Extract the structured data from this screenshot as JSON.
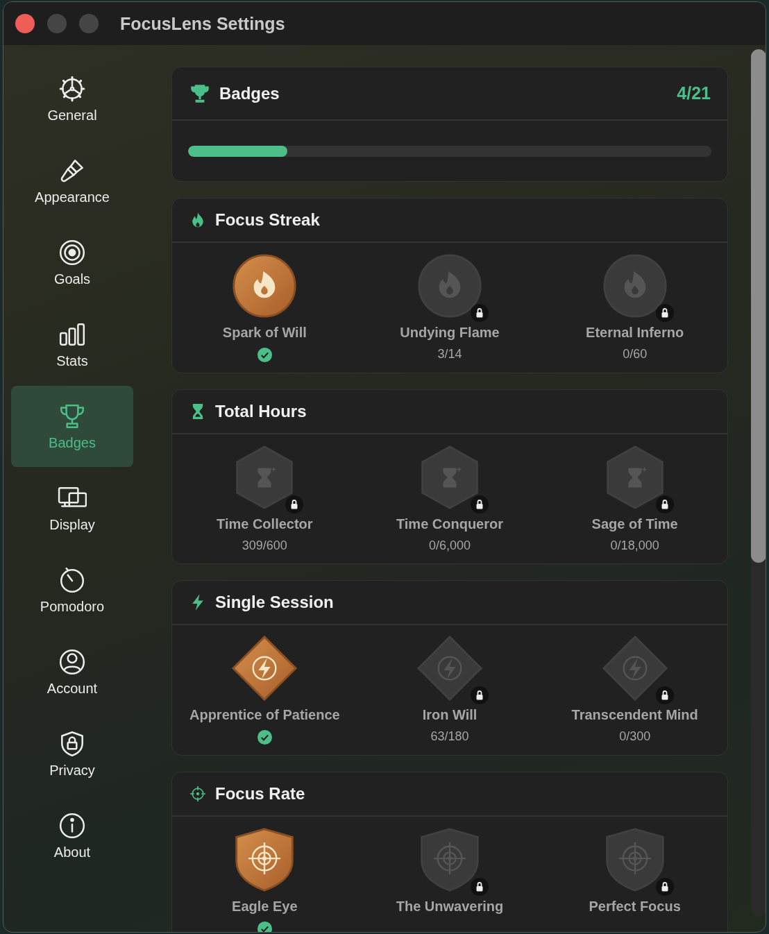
{
  "window": {
    "title": "FocusLens Settings"
  },
  "sidebar": {
    "items": [
      {
        "label": "General",
        "selected": false
      },
      {
        "label": "Appearance",
        "selected": false
      },
      {
        "label": "Goals",
        "selected": false
      },
      {
        "label": "Stats",
        "selected": false
      },
      {
        "label": "Badges",
        "selected": true
      },
      {
        "label": "Display",
        "selected": false
      },
      {
        "label": "Pomodoro",
        "selected": false
      },
      {
        "label": "Account",
        "selected": false
      },
      {
        "label": "Privacy",
        "selected": false
      },
      {
        "label": "About",
        "selected": false
      }
    ]
  },
  "summary": {
    "title": "Badges",
    "count": "4/21",
    "level": 0.19
  },
  "sections": [
    {
      "kind": "streak",
      "title": "Focus Streak",
      "badges": [
        {
          "name": "Spark of Will",
          "unlocked": true
        },
        {
          "name": "Undying Flame",
          "unlocked": false,
          "progress": "3/14"
        },
        {
          "name": "Eternal Inferno",
          "unlocked": false,
          "progress": "0/60"
        }
      ]
    },
    {
      "kind": "hours",
      "title": "Total Hours",
      "badges": [
        {
          "name": "Time Collector",
          "unlocked": false,
          "progress": "309/600"
        },
        {
          "name": "Time Conqueror",
          "unlocked": false,
          "progress": "0/6,000"
        },
        {
          "name": "Sage of Time",
          "unlocked": false,
          "progress": "0/18,000"
        }
      ]
    },
    {
      "kind": "session",
      "title": "Single Session",
      "badges": [
        {
          "name": "Apprentice of Patience",
          "unlocked": true
        },
        {
          "name": "Iron Will",
          "unlocked": false,
          "progress": "63/180"
        },
        {
          "name": "Transcendent Mind",
          "unlocked": false,
          "progress": "0/300"
        }
      ]
    },
    {
      "kind": "rate",
      "title": "Focus Rate",
      "badges": [
        {
          "name": "Eagle Eye",
          "unlocked": true
        },
        {
          "name": "The Unwavering",
          "unlocked": false
        },
        {
          "name": "Perfect Focus",
          "unlocked": false
        }
      ]
    }
  ]
}
